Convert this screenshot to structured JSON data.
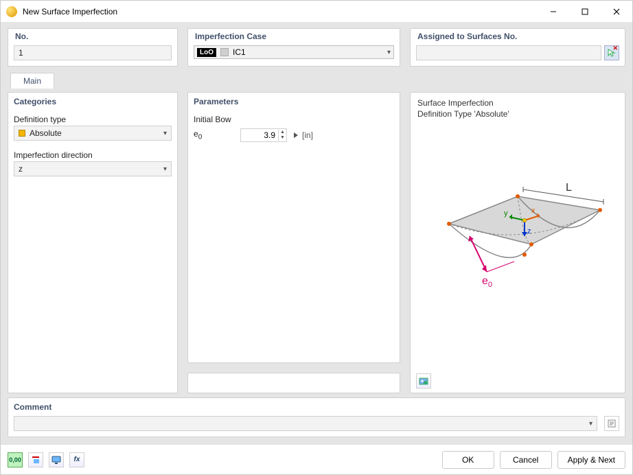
{
  "window": {
    "title": "New Surface Imperfection"
  },
  "top": {
    "no_label": "No.",
    "no_value": "1",
    "impcase_label": "Imperfection Case",
    "impcase_badge": "LoO",
    "impcase_value": "IC1",
    "assigned_label": "Assigned to Surfaces No.",
    "assigned_value": ""
  },
  "tabs": {
    "main": "Main"
  },
  "categories": {
    "header": "Categories",
    "deftype_label": "Definition type",
    "deftype_value": "Absolute",
    "impdir_label": "Imperfection direction",
    "impdir_value": "z"
  },
  "parameters": {
    "header": "Parameters",
    "initialbow_label": "Initial Bow",
    "symbol": "e",
    "subscript": "0",
    "value": "3.9",
    "unit": "[in]"
  },
  "preview": {
    "line1": "Surface Imperfection",
    "line2": "Definition Type 'Absolute'",
    "labels": {
      "L": "L",
      "x": "x",
      "y": "y",
      "z": "z",
      "e0": "e",
      "e0_sub": "0"
    }
  },
  "comment": {
    "header": "Comment",
    "value": ""
  },
  "footer": {
    "ok": "OK",
    "cancel": "Cancel",
    "applynext": "Apply & Next"
  },
  "icons": {
    "units": "0,00",
    "fx": "fx"
  }
}
